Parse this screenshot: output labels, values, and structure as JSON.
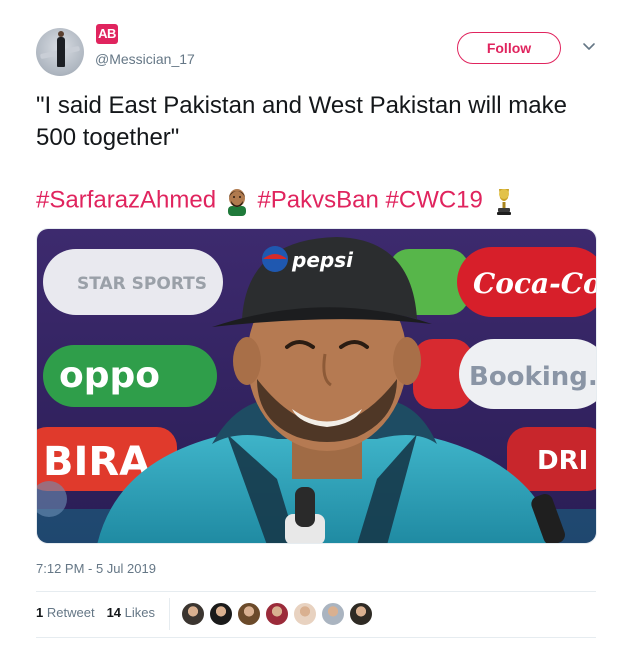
{
  "tweet": {
    "brand_badge": "AB",
    "handle": "@Messician_17",
    "follow_label": "Follow",
    "text": "\"I said East Pakistan and West Pakistan will make 500 together\"",
    "hashtags": [
      "#SarfarazAhmed",
      "#PakvsBan",
      "#CWC19"
    ],
    "timestamp": "7:12 PM - 5 Jul 2019",
    "retweets_count": "1",
    "retweets_label": "Retweet",
    "likes_count": "14",
    "likes_label": "Likes"
  },
  "media": {
    "sponsor_logos": [
      "STAR SPORTS",
      "oppo",
      "Coca-Cola",
      "Booking.c",
      "pepsi",
      "BIRA",
      "DRI"
    ]
  },
  "likers": [
    "#3b3530",
    "#1a1a1a",
    "#6b4a2a",
    "#9b2b3a",
    "#e8d2c0",
    "#aab4c0",
    "#2e2a24"
  ],
  "colors": {
    "accent": "#e0245e",
    "secondary_text": "#657786",
    "primary_text": "#14171a",
    "divider": "#e6ecf0"
  },
  "icons": [
    "chevron-down-icon",
    "man-emoji-icon",
    "trophy-icon"
  ]
}
